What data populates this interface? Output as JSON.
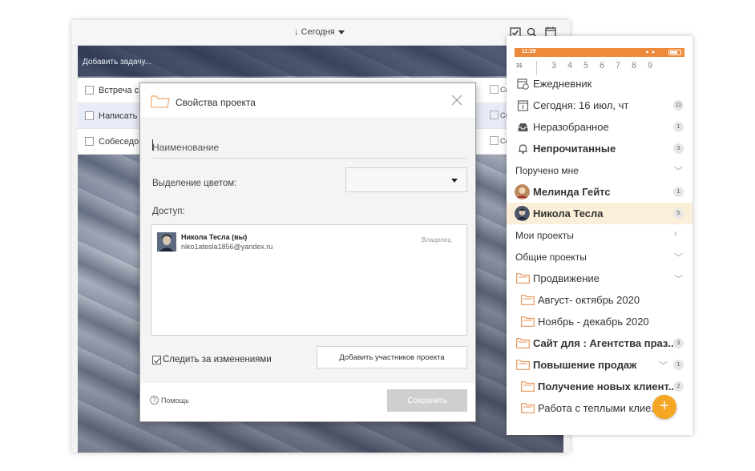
{
  "desktop": {
    "toolbar": {
      "sort_label": "↓ Сегодня"
    },
    "add_task_placeholder": "Добавить задачу...",
    "tasks": [
      {
        "label": "Встреча с",
        "date": "Се"
      },
      {
        "label": "Написать",
        "date": "Се"
      },
      {
        "label": "Собеседов",
        "date": "Се"
      }
    ]
  },
  "dialog": {
    "title": "Свойства проекта",
    "name_placeholder": "Наименование",
    "color_label": "Выделение цветом:",
    "access_label": "Доступ:",
    "member": {
      "name": "Никола Тесла (вы)",
      "email": "niko1atesla1856@yandex.ru",
      "role": "Владелец"
    },
    "watch_label": "Следить за изменениями",
    "add_members_label": "Добавить участников проекта",
    "help_label": "Помощь",
    "save_label": "Сохранить"
  },
  "phone": {
    "status": {
      "time": "11:29"
    },
    "dates": {
      "month_day": "31",
      "days": [
        "3",
        "4",
        "5",
        "6",
        "7",
        "8",
        "9"
      ]
    },
    "items": [
      {
        "label": "Ежедневник"
      },
      {
        "label": "Сегодня: 16 июл, чт",
        "count": "11"
      },
      {
        "label": "Неразобранное",
        "count": "1"
      },
      {
        "label": "Непрочитанные",
        "count": "3"
      },
      {
        "label": "Поручено мне"
      },
      {
        "label": "Мелинда Гейтс",
        "count": "1"
      },
      {
        "label": "Никола Тесла",
        "count": "5"
      },
      {
        "label": "Мои проекты"
      },
      {
        "label": "Общие проекты"
      },
      {
        "label": "Продвижение"
      },
      {
        "label": "Август- октябрь 2020"
      },
      {
        "label": "Ноябрь - декабрь 2020"
      },
      {
        "label": "Сайт для : Агентства праз..",
        "count": "3"
      },
      {
        "label": "Повышение продаж",
        "count": "1"
      },
      {
        "label": "Получение новых клиент..",
        "count": "2"
      },
      {
        "label": "Работа с теплыми клие..."
      }
    ],
    "fab_label": "+"
  },
  "colors": {
    "accent": "#ee8a3c",
    "fab": "#f5a623",
    "folder": "#f0b27a",
    "highlight": "#fcefd9"
  }
}
